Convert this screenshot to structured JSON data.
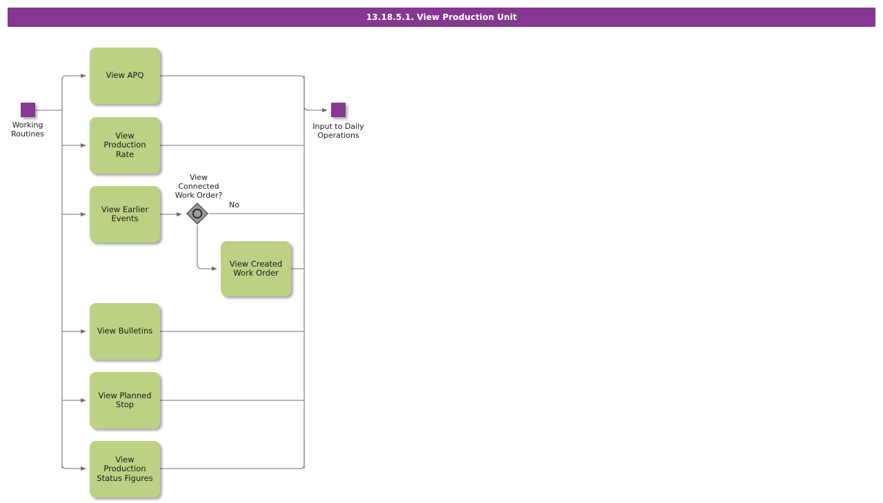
{
  "header": {
    "title": "13.18.5.1. View Production Unit",
    "background_color": "#84388f",
    "text_color": "#ffffff"
  },
  "diagram": {
    "type": "bpmn-process-flow",
    "colors": {
      "task_fill": "#bcd183",
      "event_fill": "#84388f",
      "gateway_fill": "#9a9a9a",
      "connector": "#707070",
      "text": "#1a1a1a"
    },
    "start_event": {
      "name": "start-event",
      "label": "Working\nRoutines"
    },
    "end_event": {
      "name": "end-event",
      "label": "Input to Daily\nOperations"
    },
    "gateway": {
      "name": "gateway-view-connected-work-order",
      "label": "View\nConnected\nWork Order?",
      "kind": "event-based-gateway",
      "branch_no_label": "No"
    },
    "tasks": [
      {
        "id": "view-apq",
        "label": "View APQ"
      },
      {
        "id": "view-production-rate",
        "label": "View Production\nRate"
      },
      {
        "id": "view-earlier-events",
        "label": "View Earlier\nEvents"
      },
      {
        "id": "view-created-work-order",
        "label": "View Created\nWork Order"
      },
      {
        "id": "view-bulletins",
        "label": "View Bulletins"
      },
      {
        "id": "view-planned-stop",
        "label": "View Planned\nStop"
      },
      {
        "id": "view-production-status-figures",
        "label": "View Production\nStatus Figures"
      }
    ]
  }
}
